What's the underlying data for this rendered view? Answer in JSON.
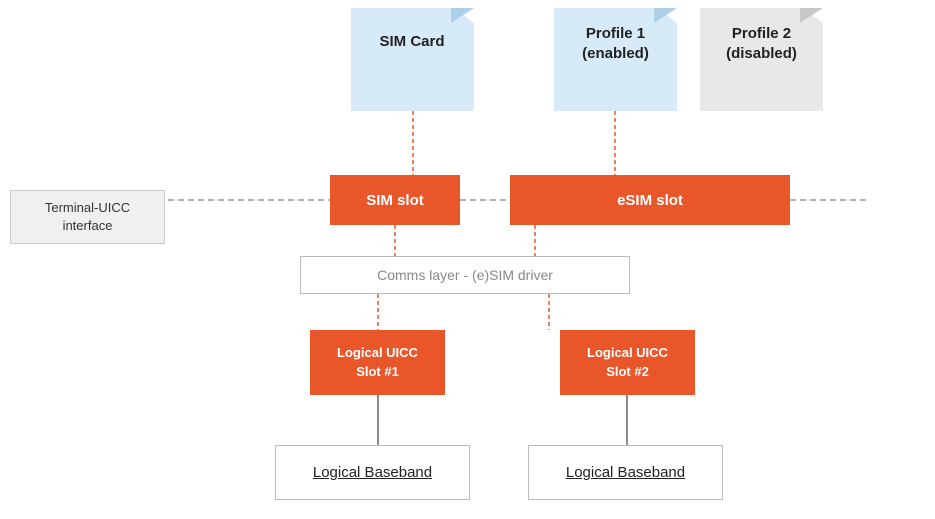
{
  "simCard": {
    "label": "SIM\nCard"
  },
  "profile1": {
    "label": "Profile 1\n(enabled)"
  },
  "profile2": {
    "label": "Profile 2\n(disabled)"
  },
  "terminalUicc": {
    "label": "Terminal-UICC interface"
  },
  "simSlot": {
    "label": "SIM slot"
  },
  "esimSlot": {
    "label": "eSIM slot"
  },
  "commsLayer": {
    "label": "Comms layer - (e)SIM driver"
  },
  "logical1": {
    "label": "Logical UICC\nSlot #1"
  },
  "logical2": {
    "label": "Logical UICC\nSlot #2"
  },
  "baseband1": {
    "label": "Logical  Baseband"
  },
  "baseband2": {
    "label": "Logical Baseband"
  }
}
